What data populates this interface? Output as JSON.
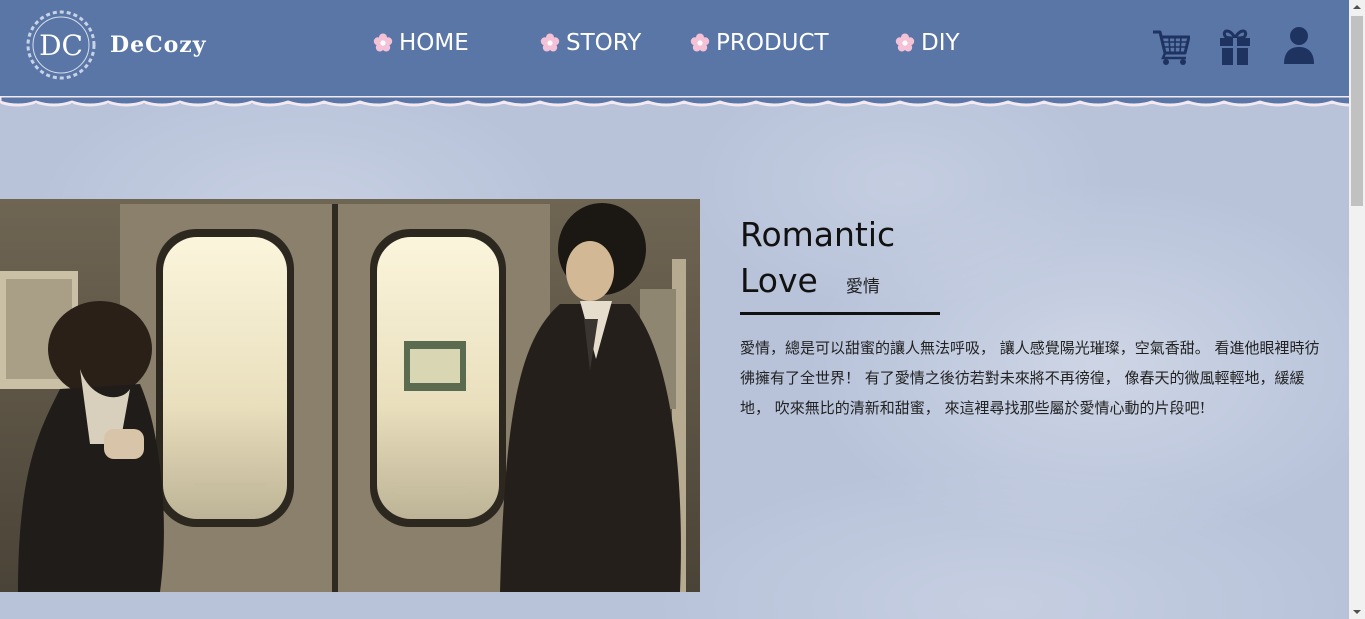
{
  "header": {
    "brand": "DeCozy",
    "logo_monogram": "DC",
    "nav": [
      {
        "label": "HOME"
      },
      {
        "label": "STORY"
      },
      {
        "label": "PRODUCT"
      },
      {
        "label": "DIY"
      }
    ],
    "icons": [
      "cart-icon",
      "gift-icon",
      "user-icon"
    ]
  },
  "main": {
    "title_line1": "Romantic",
    "title_line2": "Love",
    "subtitle": "愛情",
    "description": "愛情，總是可以甜蜜的讓人無法呼吸， 讓人感覺陽光璀璨，空氣香甜。 看進他眼裡時彷彿擁有了全世界！ 有了愛情之後彷若對未來將不再徬徨， 像春天的微風輕輕地，緩緩地， 吹來無比的清新和甜蜜， 來這裡尋找那些屬於愛情心動的片段吧!",
    "photo_alt": "scene-photo"
  },
  "colors": {
    "header_bg": "#5a76a6",
    "page_bg": "#b8c3da",
    "flower_pink": "#f4c1d6",
    "icon_navy": "#1f3361"
  }
}
